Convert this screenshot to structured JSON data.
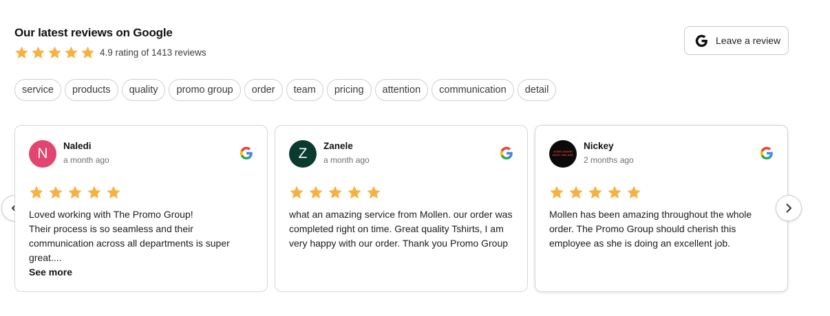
{
  "header": {
    "title": "Our latest reviews on Google",
    "rating_text": "4.9 rating of 1413 reviews",
    "stars": 5
  },
  "leave_review": {
    "label": "Leave a review",
    "icon": "google-g-icon"
  },
  "tags": [
    "service",
    "products",
    "quality",
    "promo group",
    "order",
    "team",
    "pricing",
    "attention",
    "communication",
    "detail"
  ],
  "reviews": [
    {
      "initial": "N",
      "name": "Naledi",
      "date": "a month ago",
      "stars": 5,
      "text": "Loved working with The Promo Group!\nTheir process is so seamless and their communication across all departments is super great....",
      "see_more": "See more"
    },
    {
      "initial": "Z",
      "name": "Zanele",
      "date": "a month ago",
      "stars": 5,
      "text": "what an amazing service from Mollen. our order was completed right on time. Great quality Tshirts, I am very happy with our order. Thank you Promo Group"
    },
    {
      "avatar_text": [
        "SOME AWARE",
        "MOST AWLASS"
      ],
      "name": "Nickey",
      "date": "2 months ago",
      "stars": 5,
      "text": "Mollen has been amazing throughout the whole order. The Promo Group should cherish this employee as she is doing an excellent job."
    }
  ],
  "colors": {
    "star": "#f6b13f",
    "avatar_n": "#e2456f",
    "avatar_z": "#0b3b2e",
    "avatar_nickey": "#0a0a0a"
  }
}
